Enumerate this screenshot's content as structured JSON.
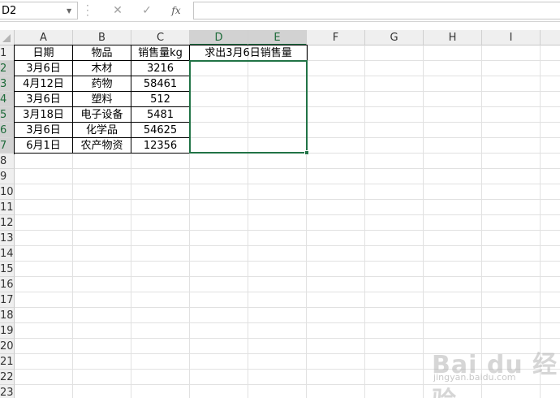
{
  "name_box": {
    "value": "D2"
  },
  "formula_bar": {
    "cancel_glyph": "✕",
    "enter_glyph": "✓",
    "fx_label": "fx",
    "value": ""
  },
  "columns": [
    "A",
    "B",
    "C",
    "D",
    "E",
    "F",
    "G",
    "H",
    "I"
  ],
  "selected_columns": [
    "D",
    "E"
  ],
  "rows": [
    "1",
    "2",
    "3",
    "4",
    "5",
    "6",
    "7",
    "8",
    "9",
    "10",
    "11",
    "12",
    "13",
    "14",
    "15",
    "16",
    "17",
    "18",
    "19",
    "20",
    "21",
    "22",
    "23"
  ],
  "selected_rows": [
    "2",
    "3",
    "4",
    "5",
    "6",
    "7"
  ],
  "table": {
    "headers": {
      "date": "日期",
      "item": "物品",
      "sales": "销售量kg"
    },
    "question": "求出3月6日销售量",
    "rows": [
      {
        "date": "3月6日",
        "item": "木材",
        "sales": "3216"
      },
      {
        "date": "4月12日",
        "item": "药物",
        "sales": "58461"
      },
      {
        "date": "3月6日",
        "item": "塑料",
        "sales": "512"
      },
      {
        "date": "3月18日",
        "item": "电子设备",
        "sales": "5481"
      },
      {
        "date": "3月6日",
        "item": "化学品",
        "sales": "54625"
      },
      {
        "date": "6月1日",
        "item": "农产物资",
        "sales": "12356"
      }
    ]
  },
  "selection_range": "D2:E7",
  "colors": {
    "accent": "#217346",
    "header_bg": "#efefef",
    "gridline": "#e1e1e1"
  },
  "watermark": {
    "text": "Bai du 经验",
    "subtext": "jingyan.baidu.com"
  }
}
